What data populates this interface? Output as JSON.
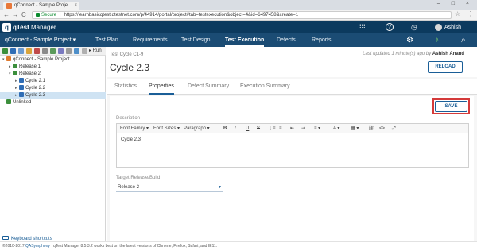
{
  "browser": {
    "tab_title": "qConnect - Sample Proje",
    "tab_close": "×",
    "window_controls": "–  □  ×",
    "secure_label": "Secure",
    "url": "https://learnbasicqtest.qtestnet.com/p/44914/portal/project#tab=testexecution&object=4&id=6497458&create=1",
    "back": "←",
    "forward": "→",
    "refresh": "C",
    "star": "☆",
    "menu": "⋮"
  },
  "app": {
    "logo_letter": "q",
    "logo_brand": "qTest",
    "logo_product": "Manager",
    "user_name": "Ashish Anand",
    "icons": {
      "apps": "⁞⁞⁞",
      "help": "?",
      "clock": "◷",
      "gear": "⚙",
      "bell": "♪",
      "search": "⌕"
    }
  },
  "nav": {
    "project": "qConnect - Sample Project ▾",
    "items": [
      "Test Plan",
      "Requirements",
      "Test Design",
      "Test Execution",
      "Defects",
      "Reports"
    ],
    "active_index": 3
  },
  "tree": {
    "toolbar_run_label": "▸ Run",
    "nodes": [
      {
        "label": "qConnect - Sample Project",
        "level": 0,
        "twisty": "▾",
        "color": "#e07a2e"
      },
      {
        "label": "Release 1",
        "level": 1,
        "twisty": "▸",
        "color": "#3c8f3c"
      },
      {
        "label": "Release 2",
        "level": 1,
        "twisty": "▾",
        "color": "#3c8f3c"
      },
      {
        "label": "Cycle 2.1",
        "level": 2,
        "twisty": "▸",
        "color": "#2f6db5"
      },
      {
        "label": "Cycle 2.2",
        "level": 2,
        "twisty": "▸",
        "color": "#2f6db5"
      },
      {
        "label": "Cycle 2.3",
        "level": 2,
        "twisty": "▸",
        "color": "#2f6db5",
        "selected": true
      },
      {
        "label": "Unlinked",
        "level": 0,
        "twisty": "",
        "color": "#3c8f3c"
      }
    ],
    "keyboard_shortcuts": "Keyboard shortcuts"
  },
  "main": {
    "breadcrumb": "Test Cycle CL-9",
    "title": "Cycle 2.3",
    "updated_prefix": "Last updated 1 minute(s) ago by",
    "updated_user": "Ashish Anand",
    "reload_label": "RELOAD",
    "tabs": [
      "Statistics",
      "Properties",
      "Defect Summary",
      "Execution Summary"
    ],
    "active_tab": 1,
    "save_label": "SAVE",
    "description_label": "Description",
    "editor_tools": {
      "font_family": "Font Family ▾",
      "font_sizes": "Font Sizes ▾",
      "paragraph": "Paragraph ▾",
      "bold": "B",
      "italic": "I",
      "underline": "U",
      "strike": "S",
      "ol": "⋮≡",
      "ul": "≡",
      "outdent": "⇤",
      "indent": "⇥",
      "align": "≡ ▾",
      "color": "A ▾",
      "table": "▦ ▾",
      "link": "⛓",
      "code": "<>",
      "full": "⤢"
    },
    "description_value": "Cycle 2.3",
    "target_label": "Target Release/Build",
    "target_value": "Release 2",
    "target_chev": "▼"
  },
  "footer": {
    "copyright": "©2010-2017",
    "company": "QASymphony",
    "note": "qTest Manager 8.5.3.2 works best on the latest versions of Chrome, Firefox, Safari, and IE11."
  },
  "colors": {
    "header_dark": "#0c3a5e",
    "nav_blue": "#1b4c74",
    "accent": "#1a5e97",
    "highlight_red": "#d43a3a",
    "tree_selected": "#cfe3f3"
  }
}
